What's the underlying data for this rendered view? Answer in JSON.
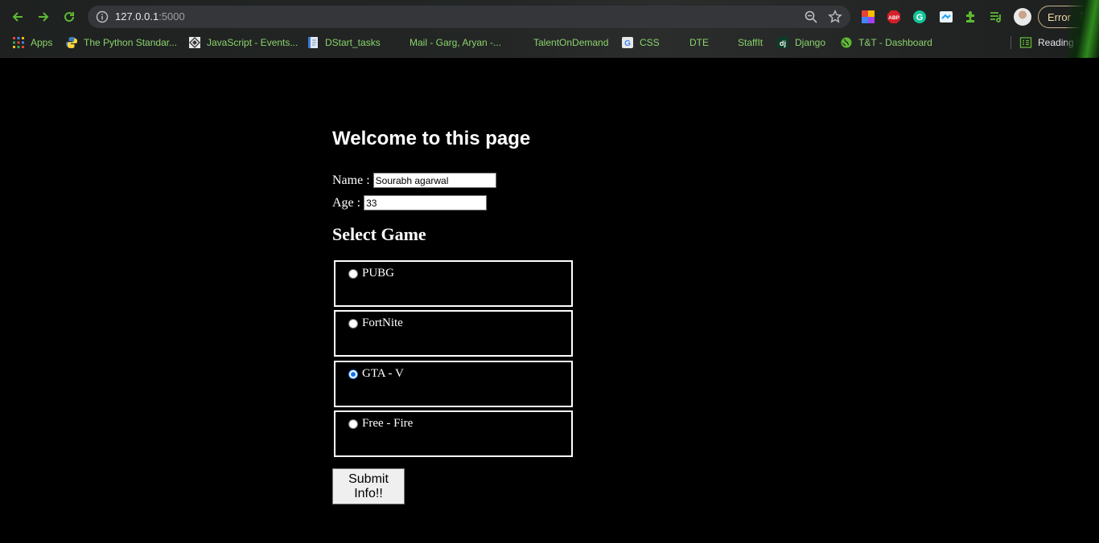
{
  "browser": {
    "url_host": "127.0.0.1",
    "url_port": ":5000",
    "error_label": "Error"
  },
  "bookmarks": [
    {
      "label": "Apps",
      "icon": "apps-grid-icon"
    },
    {
      "label": "The Python Standar...",
      "icon": "python-icon"
    },
    {
      "label": "JavaScript - Events...",
      "icon": "js-site-icon"
    },
    {
      "label": "DStart_tasks",
      "icon": "doc-icon"
    },
    {
      "label": "Mail - Garg, Aryan -...",
      "icon": "microsoft-icon"
    },
    {
      "label": "TalentOnDemand",
      "icon": "microsoft-icon"
    },
    {
      "label": "CSS",
      "icon": "google-icon"
    },
    {
      "label": "DTE",
      "icon": "microsoft-icon"
    },
    {
      "label": "StaffIt",
      "icon": "microsoft-icon"
    },
    {
      "label": "Django",
      "icon": "django-icon"
    },
    {
      "label": "T&T - Dashboard",
      "icon": "globe-icon"
    }
  ],
  "reading_list": "Reading list",
  "page": {
    "heading": "Welcome to this page",
    "name_label": "Name :",
    "name_value": "Sourabh agarwal",
    "age_label": "Age :",
    "age_value": "33",
    "select_heading": "Select Game",
    "games": [
      {
        "label": "PUBG",
        "checked": false
      },
      {
        "label": "FortNite",
        "checked": false
      },
      {
        "label": "GTA - V",
        "checked": true
      },
      {
        "label": "Free - Fire",
        "checked": false
      }
    ],
    "submit_label": "Submit Info!!"
  },
  "colors": {
    "page_bg": "#000000",
    "bookmark_text": "#8ad36b",
    "radio_checked": "#1a73e8"
  }
}
